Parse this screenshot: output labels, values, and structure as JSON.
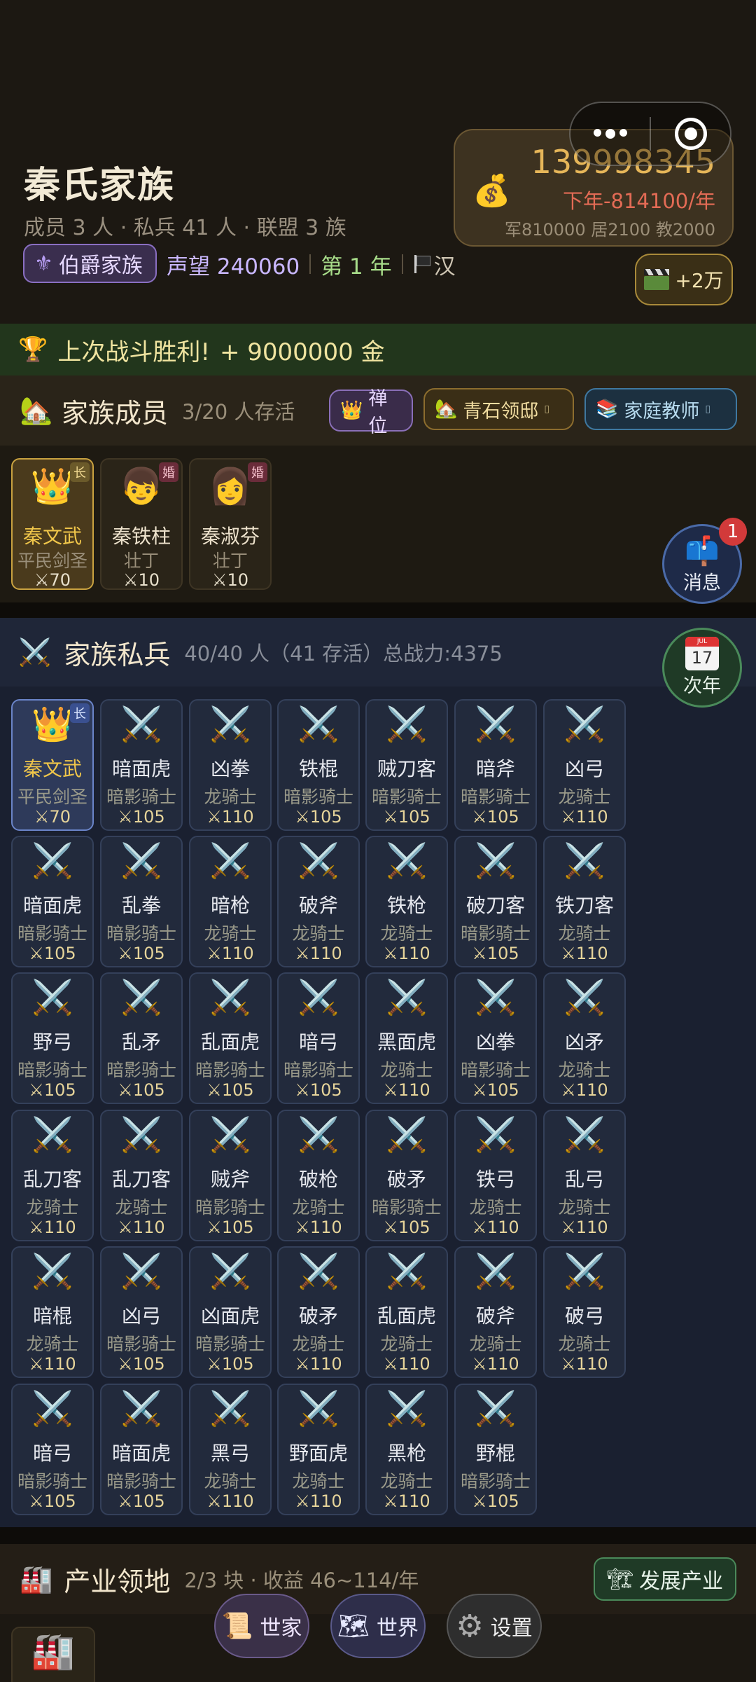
{
  "header": {
    "family_name": "秦氏家族",
    "stats": "成员 3 人 · 私兵 41 人 · 联盟 3 族",
    "title_badge": "伯爵家族",
    "prestige": "声望 240060",
    "year": "第 1 年",
    "nation": "汉",
    "money": {
      "gold": "139998345",
      "income": "下年-814100/年",
      "breakdown": "军810000 居2100 教2000"
    },
    "reward_button": "+2万"
  },
  "victory": {
    "text": "上次战斗胜利!",
    "reward": "+ 9000000 金"
  },
  "members": {
    "title": "家族成员",
    "count": "3/20 人存活",
    "abdicate_label": "禅位",
    "manor_label": "青石领邸",
    "tutor_label": "家庭教师",
    "list": [
      {
        "emoji": "👑",
        "tag": "长",
        "name": "秦文武",
        "rank": "平民剑圣",
        "power": "⚔70"
      },
      {
        "emoji": "👦",
        "tag": "婚",
        "name": "秦铁柱",
        "rank": "壮丁",
        "power": "⚔10"
      },
      {
        "emoji": "👩",
        "tag": "婚",
        "name": "秦淑芬",
        "rank": "壮丁",
        "power": "⚔10"
      }
    ]
  },
  "messages": {
    "label": "消息",
    "badge": "1"
  },
  "next_year": {
    "label": "次年",
    "cal_month": "JUL",
    "cal_day": "17"
  },
  "soldiers": {
    "title": "家族私兵",
    "count": "40/40 人（41 存活）总战力:4375",
    "list": [
      {
        "emoji": "👑",
        "tag": "长",
        "name": "秦文武",
        "rank": "平民剑圣",
        "power": "⚔70"
      },
      {
        "emoji": "⚔️",
        "name": "暗面虎",
        "rank": "暗影骑士",
        "power": "⚔105"
      },
      {
        "emoji": "⚔️",
        "name": "凶拳",
        "rank": "龙骑士",
        "power": "⚔110"
      },
      {
        "emoji": "⚔️",
        "name": "铁棍",
        "rank": "暗影骑士",
        "power": "⚔105"
      },
      {
        "emoji": "⚔️",
        "name": "贼刀客",
        "rank": "暗影骑士",
        "power": "⚔105"
      },
      {
        "emoji": "⚔️",
        "name": "暗斧",
        "rank": "暗影骑士",
        "power": "⚔105"
      },
      {
        "emoji": "⚔️",
        "name": "凶弓",
        "rank": "龙骑士",
        "power": "⚔110"
      },
      {
        "emoji": "⚔️",
        "name": "暗面虎",
        "rank": "暗影骑士",
        "power": "⚔105"
      },
      {
        "emoji": "⚔️",
        "name": "乱拳",
        "rank": "暗影骑士",
        "power": "⚔105"
      },
      {
        "emoji": "⚔️",
        "name": "暗枪",
        "rank": "龙骑士",
        "power": "⚔110"
      },
      {
        "emoji": "⚔️",
        "name": "破斧",
        "rank": "龙骑士",
        "power": "⚔110"
      },
      {
        "emoji": "⚔️",
        "name": "铁枪",
        "rank": "龙骑士",
        "power": "⚔110"
      },
      {
        "emoji": "⚔️",
        "name": "破刀客",
        "rank": "暗影骑士",
        "power": "⚔105"
      },
      {
        "emoji": "⚔️",
        "name": "铁刀客",
        "rank": "龙骑士",
        "power": "⚔110"
      },
      {
        "emoji": "⚔️",
        "name": "野弓",
        "rank": "暗影骑士",
        "power": "⚔105"
      },
      {
        "emoji": "⚔️",
        "name": "乱矛",
        "rank": "暗影骑士",
        "power": "⚔105"
      },
      {
        "emoji": "⚔️",
        "name": "乱面虎",
        "rank": "暗影骑士",
        "power": "⚔105"
      },
      {
        "emoji": "⚔️",
        "name": "暗弓",
        "rank": "暗影骑士",
        "power": "⚔105"
      },
      {
        "emoji": "⚔️",
        "name": "黑面虎",
        "rank": "龙骑士",
        "power": "⚔110"
      },
      {
        "emoji": "⚔️",
        "name": "凶拳",
        "rank": "暗影骑士",
        "power": "⚔105"
      },
      {
        "emoji": "⚔️",
        "name": "凶矛",
        "rank": "龙骑士",
        "power": "⚔110"
      },
      {
        "emoji": "⚔️",
        "name": "乱刀客",
        "rank": "龙骑士",
        "power": "⚔110"
      },
      {
        "emoji": "⚔️",
        "name": "乱刀客",
        "rank": "龙骑士",
        "power": "⚔110"
      },
      {
        "emoji": "⚔️",
        "name": "贼斧",
        "rank": "暗影骑士",
        "power": "⚔105"
      },
      {
        "emoji": "⚔️",
        "name": "破枪",
        "rank": "龙骑士",
        "power": "⚔110"
      },
      {
        "emoji": "⚔️",
        "name": "破矛",
        "rank": "暗影骑士",
        "power": "⚔105"
      },
      {
        "emoji": "⚔️",
        "name": "铁弓",
        "rank": "龙骑士",
        "power": "⚔110"
      },
      {
        "emoji": "⚔️",
        "name": "乱弓",
        "rank": "龙骑士",
        "power": "⚔110"
      },
      {
        "emoji": "⚔️",
        "name": "暗棍",
        "rank": "龙骑士",
        "power": "⚔110"
      },
      {
        "emoji": "⚔️",
        "name": "凶弓",
        "rank": "暗影骑士",
        "power": "⚔105"
      },
      {
        "emoji": "⚔️",
        "name": "凶面虎",
        "rank": "暗影骑士",
        "power": "⚔105"
      },
      {
        "emoji": "⚔️",
        "name": "破矛",
        "rank": "龙骑士",
        "power": "⚔110"
      },
      {
        "emoji": "⚔️",
        "name": "乱面虎",
        "rank": "龙骑士",
        "power": "⚔110"
      },
      {
        "emoji": "⚔️",
        "name": "破斧",
        "rank": "龙骑士",
        "power": "⚔110"
      },
      {
        "emoji": "⚔️",
        "name": "破弓",
        "rank": "龙骑士",
        "power": "⚔110"
      },
      {
        "emoji": "⚔️",
        "name": "暗弓",
        "rank": "暗影骑士",
        "power": "⚔105"
      },
      {
        "emoji": "⚔️",
        "name": "暗面虎",
        "rank": "暗影骑士",
        "power": "⚔105"
      },
      {
        "emoji": "⚔️",
        "name": "黑弓",
        "rank": "龙骑士",
        "power": "⚔110"
      },
      {
        "emoji": "⚔️",
        "name": "野面虎",
        "rank": "龙骑士",
        "power": "⚔110"
      },
      {
        "emoji": "⚔️",
        "name": "黑枪",
        "rank": "龙骑士",
        "power": "⚔110"
      },
      {
        "emoji": "⚔️",
        "name": "野棍",
        "rank": "暗影骑士",
        "power": "⚔105"
      }
    ]
  },
  "industry": {
    "title": "产业领地",
    "count": "2/3 块 · 收益 46~114/年",
    "develop_label": "发展产业"
  },
  "nav": {
    "home_label": "世家",
    "world_label": "世界",
    "settings_label": "设置"
  }
}
